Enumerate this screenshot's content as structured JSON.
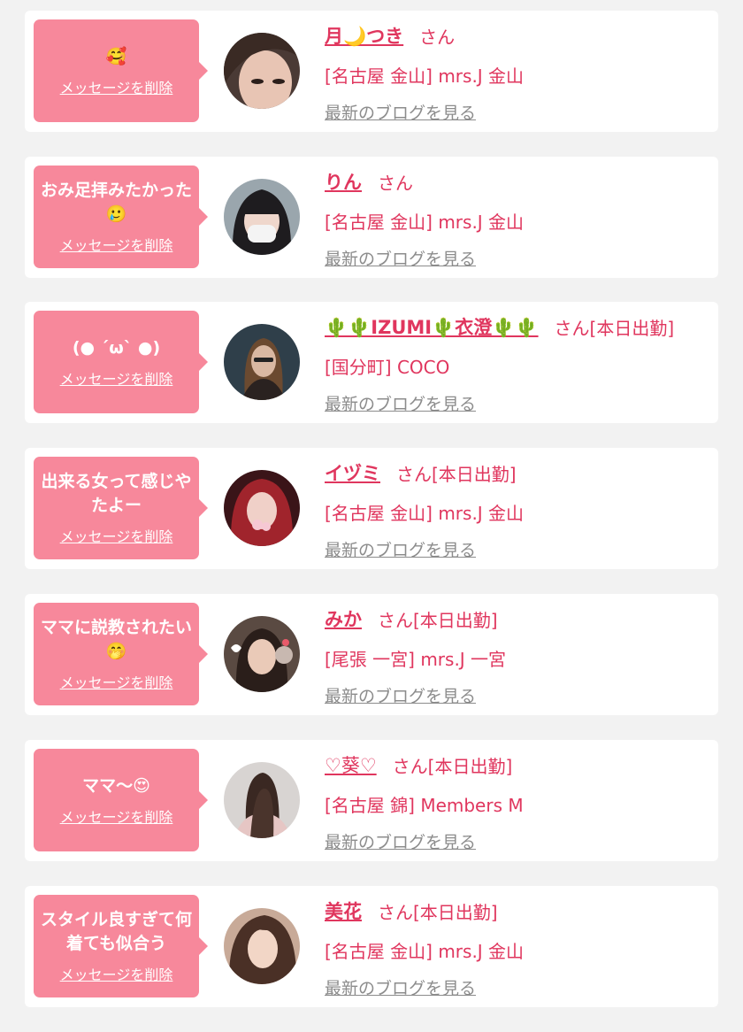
{
  "delete_label": "メッセージを削除",
  "blog_label": "最新のブログを見る",
  "colors": {
    "bubble": "#f7889b",
    "accent": "#e0365e",
    "link_gray": "#8c8c8c",
    "background": "#f2f2f2"
  },
  "messages": [
    {
      "message": "🥰",
      "name": "月🌙つき",
      "suffix": "さん",
      "shop": "[名古屋 金山] mrs.J 金山"
    },
    {
      "message": "おみ足拝みたかった🥲",
      "name": "りん",
      "suffix": "さん",
      "shop": "[名古屋 金山] mrs.J 金山"
    },
    {
      "message": "(● ˊωˋ ●)",
      "name": "🌵🌵IZUMI🌵衣澄🌵🌵",
      "suffix": "さん[本日出勤]",
      "shop": "[国分町] COCO"
    },
    {
      "message": "出来る女って感じやたよー",
      "name": "イヅミ",
      "suffix": "さん[本日出勤]",
      "shop": "[名古屋 金山] mrs.J 金山"
    },
    {
      "message": "ママに説教されたい🤭",
      "name": "みか",
      "suffix": "さん[本日出勤]",
      "shop": "[尾張 一宮] mrs.J 一宮"
    },
    {
      "message": "ママ〜😍",
      "name": "♡葵♡",
      "suffix": "さん[本日出勤]",
      "shop": "[名古屋 錦] Members M"
    },
    {
      "message": "スタイル良すぎて何着ても似合う",
      "name": "美花",
      "suffix": "さん[本日出勤]",
      "shop": "[名古屋 金山] mrs.J 金山"
    }
  ]
}
